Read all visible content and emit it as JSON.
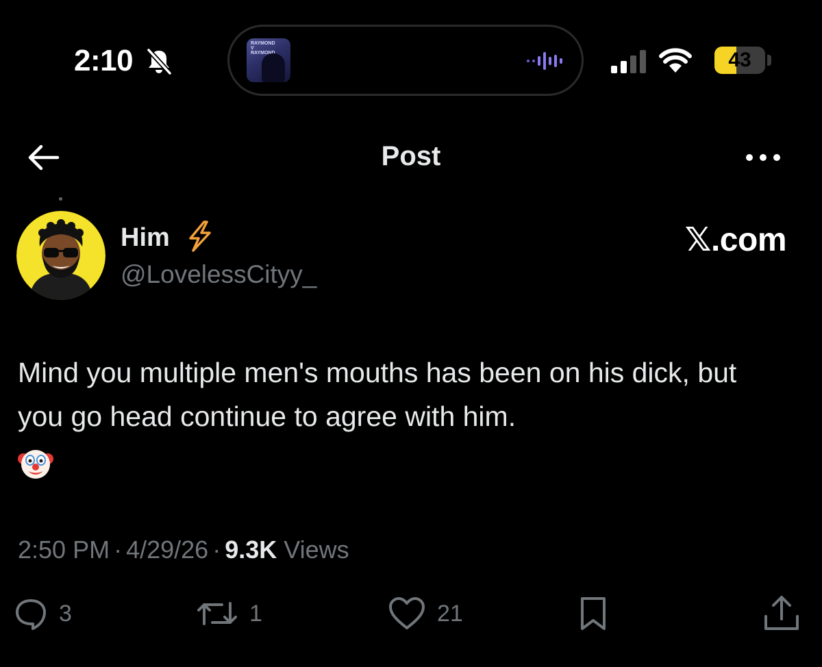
{
  "status_bar": {
    "time": "2:10",
    "battery_percent": "43",
    "battery_level": 0.43,
    "album_art_text": "RAYMOND V RAYMOND",
    "icons": [
      "bell-slash-icon",
      "waveform-icon",
      "cellular-signal-icon",
      "wifi-icon",
      "battery-icon"
    ]
  },
  "header": {
    "title": "Post",
    "icons": [
      "back-arrow-icon",
      "more-options-icon"
    ]
  },
  "post": {
    "author": {
      "name": "Him",
      "badge_icon": "lightning-bolt-icon",
      "handle": "@LovelessCityy_"
    },
    "watermark": "𝕏.com",
    "text": "Mind you multiple men's mouths has been on his dick, but you go head continue to agree with him.",
    "emoji": "🤡",
    "time": "2:50 PM",
    "separator": "·",
    "date": "4/29/26",
    "views_count": "9.3K",
    "views_label": "Views"
  },
  "actions": {
    "replies": "3",
    "reposts": "1",
    "likes": "21",
    "icons": [
      "reply-icon",
      "repost-icon",
      "like-icon",
      "bookmark-icon",
      "share-icon"
    ]
  },
  "colors": {
    "background": "#000000",
    "text_primary": "#e7e9ea",
    "text_secondary": "#71767b",
    "battery_yellow": "#f5d426",
    "avatar_yellow": "#f5e22a",
    "bolt_orange": "#f2a13a"
  }
}
